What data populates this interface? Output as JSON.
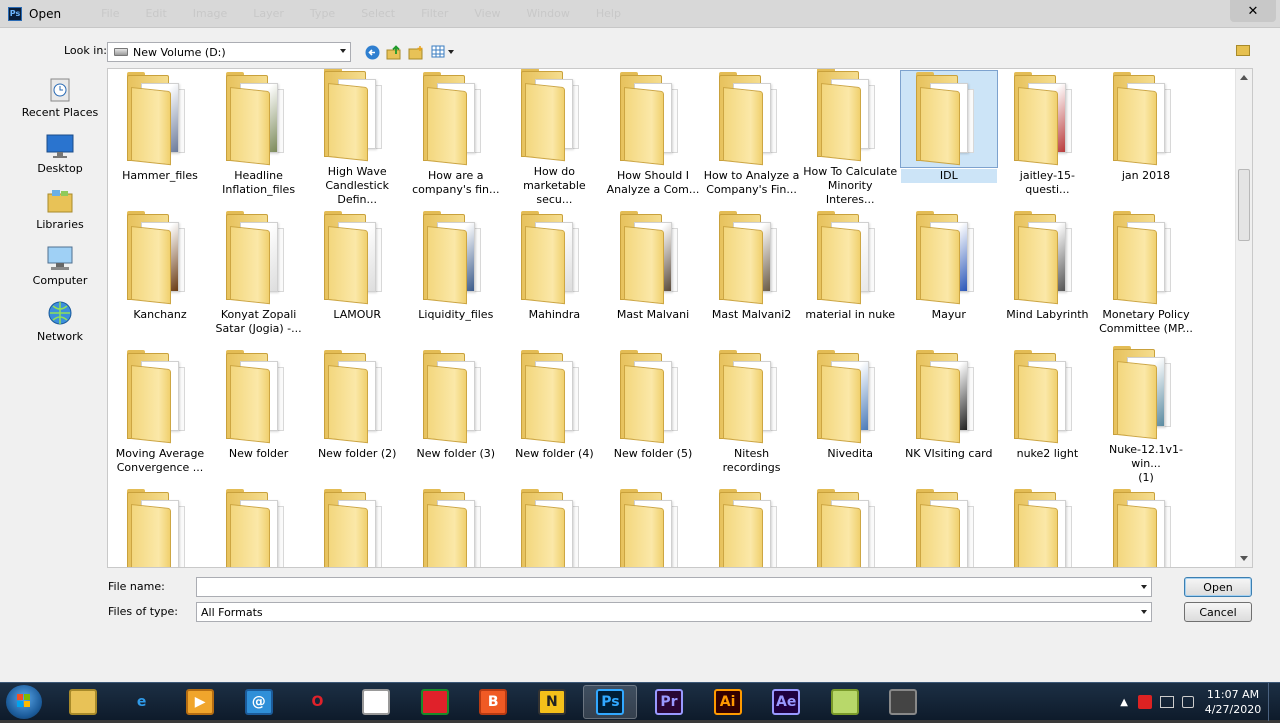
{
  "window": {
    "title": "Open",
    "app_badge": "Ps",
    "close_glyph": "✕",
    "ghost_menu": [
      "File",
      "Edit",
      "Image",
      "Layer",
      "Type",
      "Select",
      "Filter",
      "View",
      "Window",
      "Help"
    ]
  },
  "toolbar": {
    "look_in_label": "Look in:",
    "look_in_value": "New Volume (D:)"
  },
  "places": [
    {
      "label": "Recent Places",
      "icon": "recent-places-icon"
    },
    {
      "label": "Desktop",
      "icon": "desktop-icon"
    },
    {
      "label": "Libraries",
      "icon": "libraries-icon"
    },
    {
      "label": "Computer",
      "icon": "computer-icon"
    },
    {
      "label": "Network",
      "icon": "network-icon"
    }
  ],
  "rows": [
    [
      "Hammer_files",
      "Headline\nInflation_files",
      "High Wave\nCandlestick Defin...",
      "How are a\ncompany's fin...",
      "How do\nmarketable secu...",
      "How Should I\nAnalyze a Com...",
      "How to Analyze a\nCompany's Fin...",
      "How To Calculate\nMinority Interes...",
      "IDL",
      "jaitley-15-questi...",
      "jan 2018"
    ],
    [
      "Kanchanz",
      "Konyat Zopali\nSatar (Jogia) -...",
      "LAMOUR",
      "Liquidity_files",
      "Mahindra",
      "Mast Malvani",
      "Mast Malvani2",
      "material in nuke",
      "Mayur",
      "Mind Labyrinth",
      "Monetary Policy\nCommittee (MP..."
    ],
    [
      "Moving Average\nConvergence ...",
      "New folder",
      "New folder (2)",
      "New folder (3)",
      "New folder (4)",
      "New folder (5)",
      "Nitesh recordings",
      "Nivedita",
      "NK VIsiting card",
      "nuke2 light",
      "Nuke-12.1v1-win...\n(1)"
    ],
    [
      "",
      "",
      "",
      "",
      "",
      "",
      "",
      "",
      "",
      "",
      ""
    ]
  ],
  "selected_item": "IDL",
  "bottom": {
    "file_name_label": "File name:",
    "file_name_value": "",
    "files_of_type_label": "Files of type:",
    "files_of_type_value": "All Formats",
    "open_label": "Open",
    "cancel_label": "Cancel"
  },
  "taskbar": {
    "apps": [
      {
        "name": "explorer",
        "glyph": ""
      },
      {
        "name": "internet-explorer",
        "glyph": "e"
      },
      {
        "name": "media-player",
        "glyph": "▶"
      },
      {
        "name": "mail",
        "glyph": "@"
      },
      {
        "name": "opera",
        "glyph": "O"
      },
      {
        "name": "notepad",
        "glyph": ""
      },
      {
        "name": "chrome",
        "glyph": ""
      },
      {
        "name": "brave",
        "glyph": "B"
      },
      {
        "name": "nuke",
        "glyph": "N"
      },
      {
        "name": "photoshop",
        "glyph": "Ps"
      },
      {
        "name": "premiere",
        "glyph": "Pr"
      },
      {
        "name": "illustrator",
        "glyph": "Ai"
      },
      {
        "name": "after-effects",
        "glyph": "Ae"
      },
      {
        "name": "notes",
        "glyph": ""
      },
      {
        "name": "tool",
        "glyph": ""
      }
    ],
    "time": "11:07 AM",
    "date": "4/27/2020"
  },
  "colors": {
    "ps_blue": "#31a8ff",
    "pr_purple": "#9999ff",
    "ai_orange": "#ff9a00",
    "ae_violet": "#9999ff",
    "selection": "#cce4f7"
  }
}
